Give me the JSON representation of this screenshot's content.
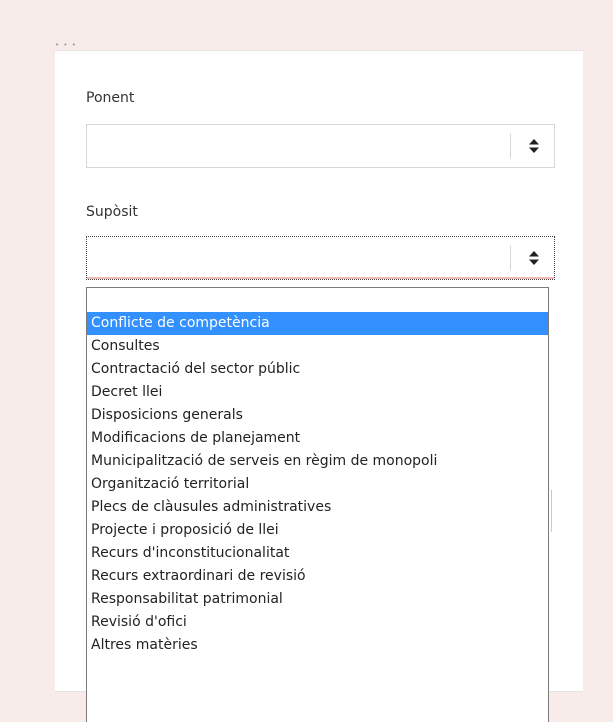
{
  "form": {
    "ponent": {
      "label": "Ponent",
      "value": ""
    },
    "suposit": {
      "label": "Supòsit",
      "value": ""
    }
  },
  "dropdown": {
    "options": [
      "Conflicte de competència",
      "Consultes",
      "Contractació del sector públic",
      "Decret llei",
      "Disposicions generals",
      "Modificacions de planejament",
      "Municipalització de serveis en règim de monopoli",
      "Organització territorial",
      "Plecs de clàusules administratives",
      "Projecte i proposició de llei",
      "Recurs d'inconstitucionalitat",
      "Recurs extraordinari de revisió",
      "Responsabilitat patrimonial",
      "Revisió d'ofici",
      "Altres matèries"
    ],
    "highlighted_option": "Conflicte de competència"
  },
  "colors": {
    "background": "#f7ece9",
    "highlight": "#3390ff"
  },
  "icons": {
    "select_arrows": "up-down-chevron-icon"
  }
}
